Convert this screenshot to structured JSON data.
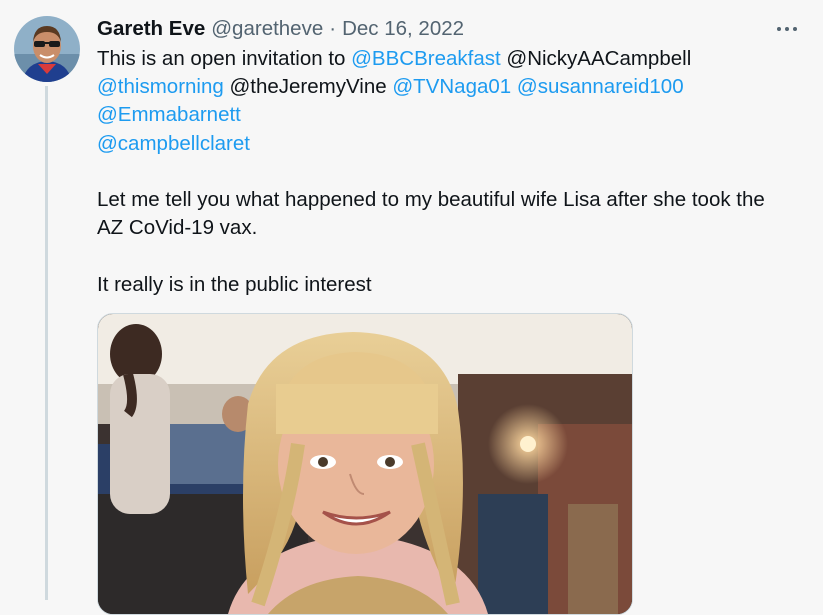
{
  "tweet": {
    "author_name": "Gareth Eve",
    "author_handle": "@garetheve",
    "separator": "·",
    "date": "Dec 16, 2022",
    "more_icon": "more-horizontal-icon",
    "text": {
      "line1_prefix": "This is an open invitation to ",
      "line1_mention1": "@BBCBreakfast",
      "line1_mention2": " @NickyAACampbell",
      "line2_mention1": "@thismorning",
      "line2_plain": " @theJeremyVine ",
      "line2_mention2": "@TVNaga01",
      "line2_space": " ",
      "line2_mention3": "@susannareid100",
      "line3_mention": "@Emmabarnett",
      "line4_mention": "@campbellclaret",
      "para2_line1": "Let me tell you what happened to my beautiful wife Lisa after she took the",
      "para2_line2": "AZ CoVid-19 vax.",
      "para3": "It really is in the public interest"
    }
  },
  "colors": {
    "background": "#f7f7f7",
    "text": "#0f1419",
    "secondary": "#536471",
    "mention": "#1d9bf0",
    "thread_line": "#cfd9de"
  }
}
